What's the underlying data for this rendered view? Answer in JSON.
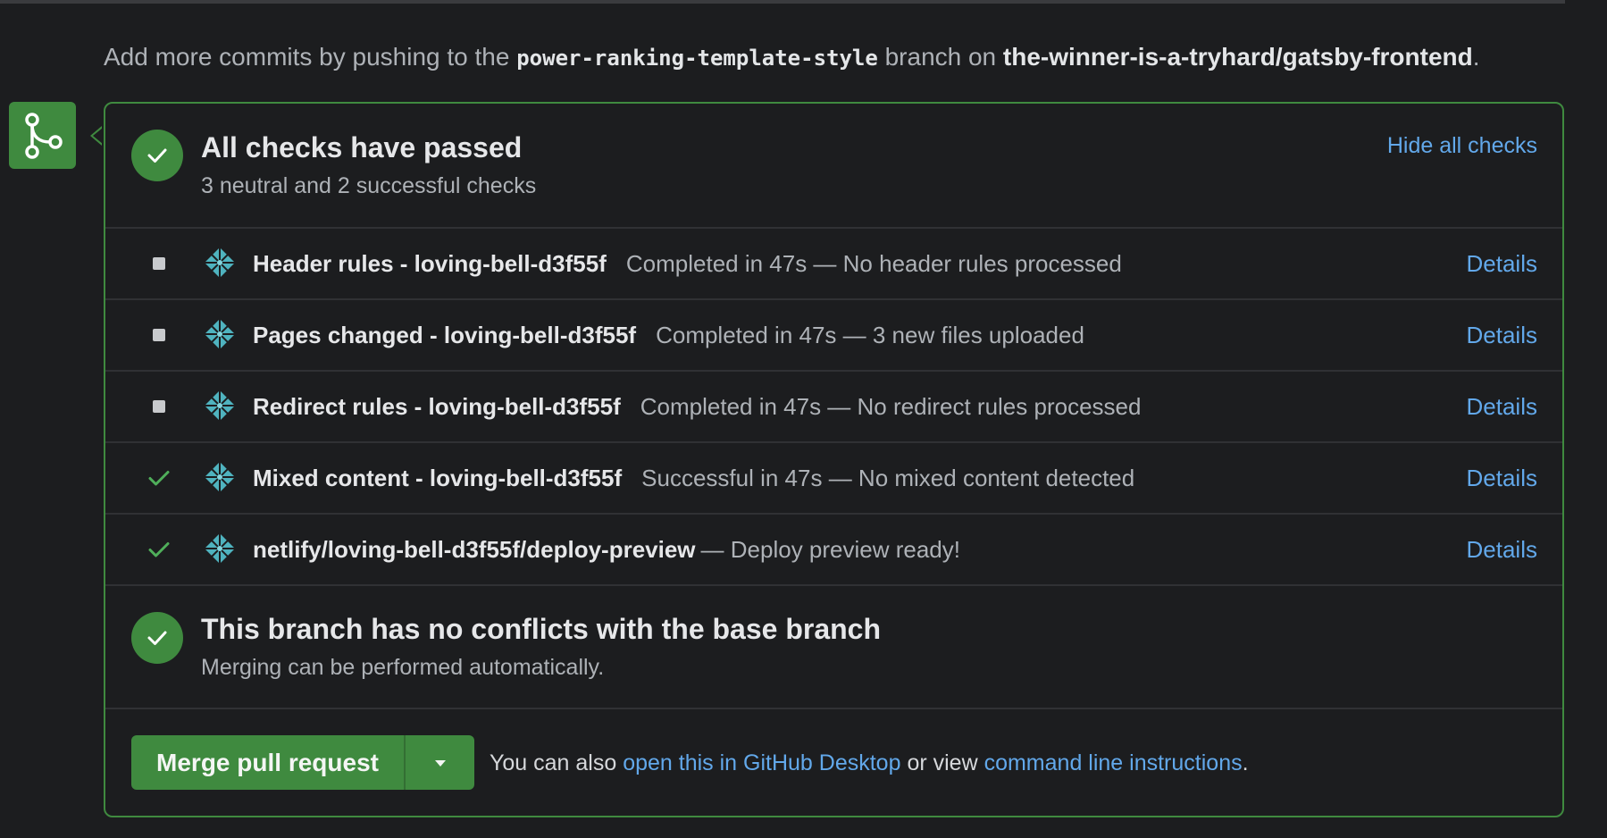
{
  "intro": {
    "prefix": "Add more commits by pushing to the",
    "branch": "power-ranking-template-style",
    "middle": "branch on",
    "repo": "the-winner-is-a-tryhard/gatsby-frontend",
    "suffix": "."
  },
  "checks_summary": {
    "title": "All checks have passed",
    "subtitle": "3 neutral and 2 successful checks",
    "hide_label": "Hide all checks"
  },
  "checks": [
    {
      "status": "neutral",
      "name": "Header rules - loving-bell-d3f55f",
      "desc": "Completed in 47s — No header rules processed",
      "details": "Details"
    },
    {
      "status": "neutral",
      "name": "Pages changed - loving-bell-d3f55f",
      "desc": "Completed in 47s — 3 new files uploaded",
      "details": "Details"
    },
    {
      "status": "neutral",
      "name": "Redirect rules - loving-bell-d3f55f",
      "desc": "Completed in 47s — No redirect rules processed",
      "details": "Details"
    },
    {
      "status": "success",
      "name": "Mixed content - loving-bell-d3f55f",
      "desc": "Successful in 47s — No mixed content detected",
      "details": "Details"
    },
    {
      "status": "success",
      "name": "netlify/loving-bell-d3f55f/deploy-preview",
      "desc": "— Deploy preview ready!",
      "details": "Details"
    }
  ],
  "conflicts": {
    "title": "This branch has no conflicts with the base branch",
    "subtitle": "Merging can be performed automatically."
  },
  "merge": {
    "button_label": "Merge pull request",
    "also_prefix": "You can also",
    "desktop_link": "open this in GitHub Desktop",
    "middle": "or view",
    "cli_link": "command line instructions",
    "suffix": "."
  },
  "colors": {
    "success_green": "#3f8a3f",
    "link_blue": "#62a8ea",
    "background": "#1c1d1f"
  },
  "icons": {
    "badge": "git-merge-icon",
    "check": "check-icon",
    "neutral": "square-neutral-icon",
    "app": "netlify-logo-icon",
    "dropdown": "triangle-down-icon"
  }
}
